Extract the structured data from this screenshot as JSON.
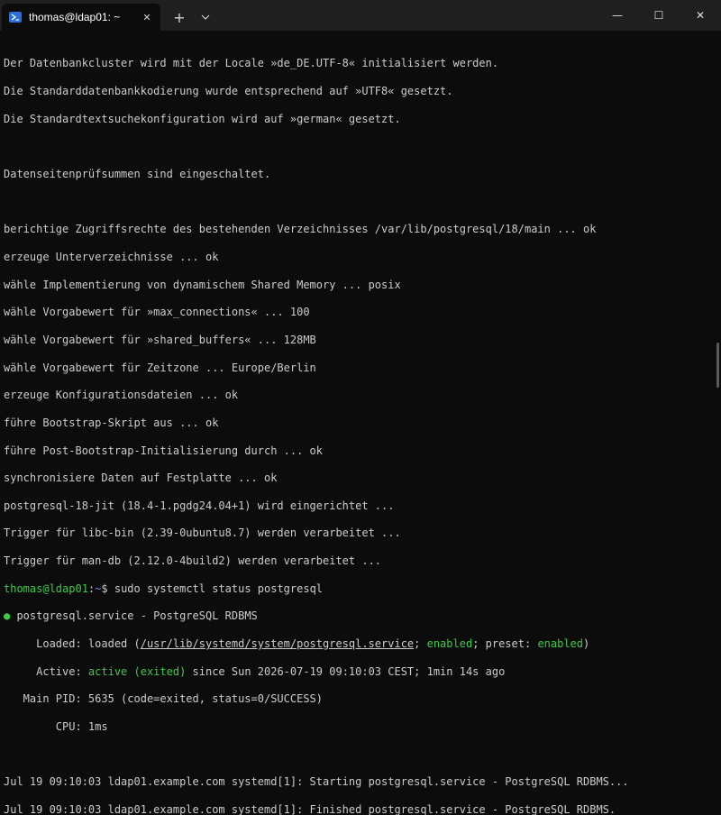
{
  "window": {
    "tab_title": "thomas@ldap01: ~",
    "tab_close": "✕",
    "new_tab": "+",
    "dropdown": "⌄",
    "minimize": "—",
    "maximize": "☐",
    "close": "✕"
  },
  "colors": {
    "background": "#0c0c0c",
    "text": "#cccccc",
    "prompt_user": "#3fc84a",
    "prompt_path": "#6b8fe0",
    "active_status": "#3fc84a"
  },
  "terminal": {
    "l1": "Der Datenbankcluster wird mit der Locale »de_DE.UTF-8« initialisiert werden.",
    "l2": "Die Standarddatenbankkodierung wurde entsprechend auf »UTF8« gesetzt.",
    "l3": "Die Standardtextsuchekonfiguration wird auf »german« gesetzt.",
    "l4": "Datenseitenprüfsummen sind eingeschaltet.",
    "l5": "berichtige Zugriffsrechte des bestehenden Verzeichnisses /var/lib/postgresql/18/main ... ok",
    "l6": "erzeuge Unterverzeichnisse ... ok",
    "l7": "wähle Implementierung von dynamischem Shared Memory ... posix",
    "l8": "wähle Vorgabewert für »max_connections« ... 100",
    "l9": "wähle Vorgabewert für »shared_buffers« ... 128MB",
    "l10": "wähle Vorgabewert für Zeitzone ... Europe/Berlin",
    "l11": "erzeuge Konfigurationsdateien ... ok",
    "l12": "führe Bootstrap-Skript aus ... ok",
    "l13": "führe Post-Bootstrap-Initialisierung durch ... ok",
    "l14": "synchronisiere Daten auf Festplatte ... ok",
    "l15": "postgresql-18-jit (18.4-1.pgdg24.04+1) wird eingerichtet ...",
    "l16": "Trigger für libc-bin (2.39-0ubuntu8.7) werden verarbeitet ...",
    "l17": "Trigger für man-db (2.12.0-4build2) werden verarbeitet ...",
    "prompt_user": "thomas@ldap01",
    "prompt_colon": ":",
    "prompt_path": "~",
    "prompt_dollar": "$ ",
    "command": "sudo systemctl status postgresql",
    "status_dot": "●",
    "status_title": " postgresql.service - PostgreSQL RDBMS",
    "loaded_label": "     Loaded: ",
    "loaded_pre": "loaded (",
    "loaded_path": "/usr/lib/systemd/system/postgresql.service",
    "loaded_mid": "; ",
    "enabled1": "enabled",
    "loaded_preset": "; preset: ",
    "enabled2": "enabled",
    "loaded_end": ")",
    "active_label": "     Active: ",
    "active_value": "active (exited)",
    "active_since": " since Sun 2026-07-19 09:10:03 CEST; 1min 14s ago",
    "mainpid": "   Main PID: 5635 (code=exited, status=0/SUCCESS)",
    "cpu": "        CPU: 1ms",
    "log1": "Jul 19 09:10:03 ldap01.example.com systemd[1]: Starting postgresql.service - PostgreSQL RDBMS...",
    "log2": "Jul 19 09:10:03 ldap01.example.com systemd[1]: Finished postgresql.service - PostgreSQL RDBMS."
  }
}
